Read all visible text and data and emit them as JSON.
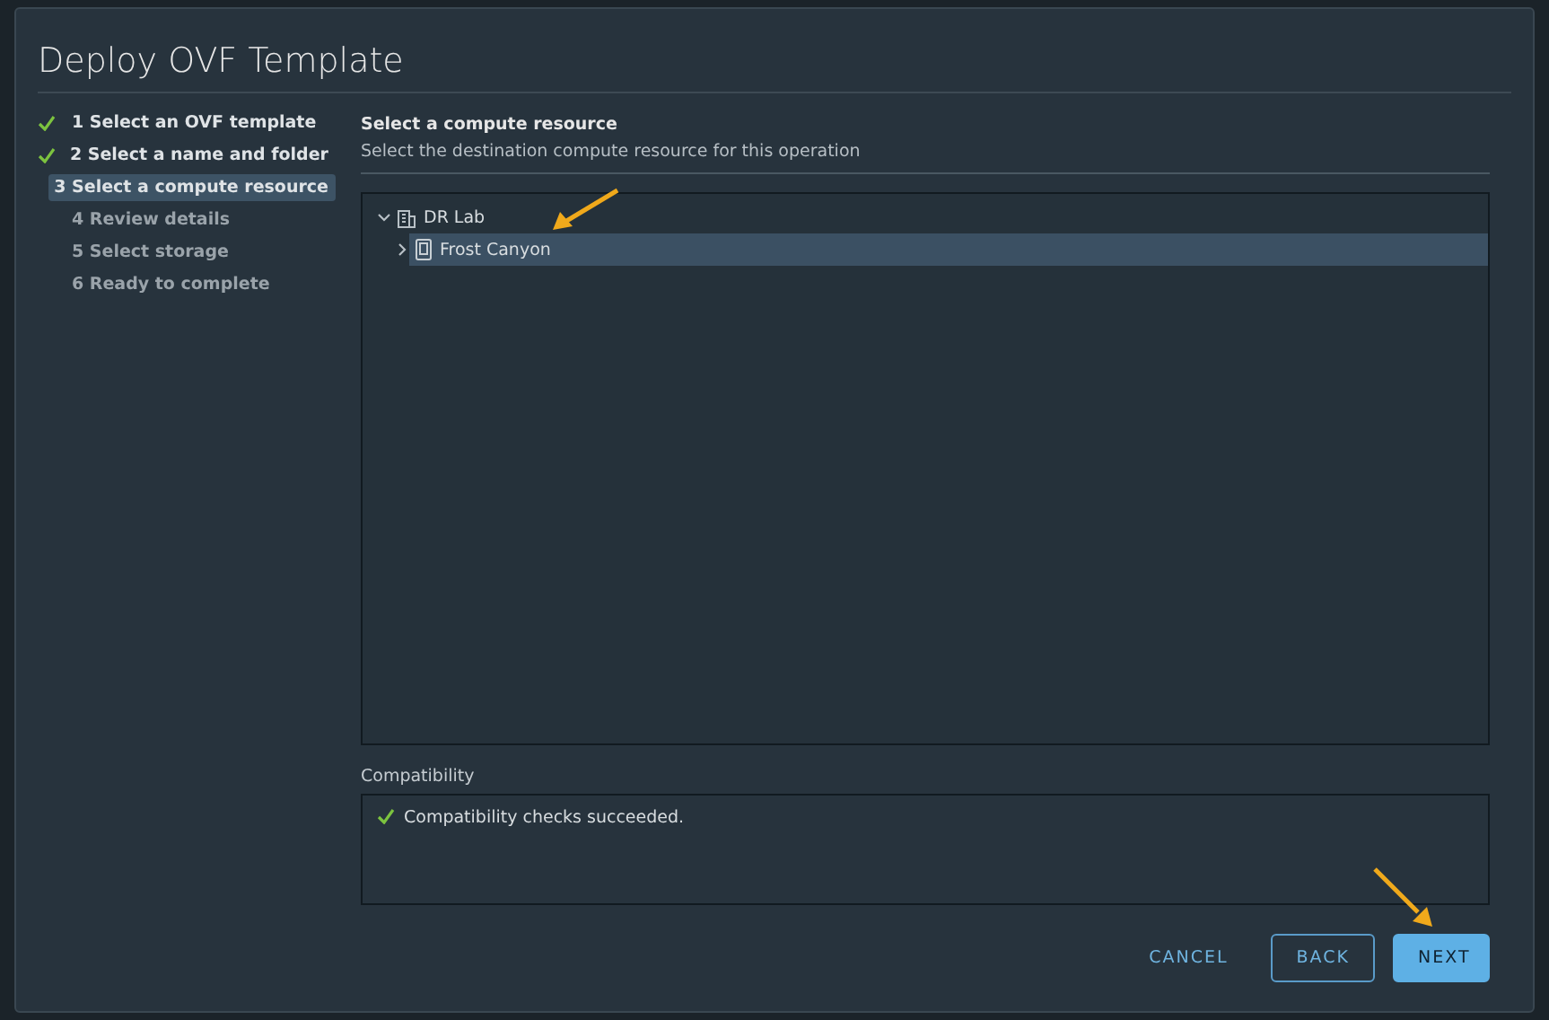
{
  "dialog": {
    "title": "Deploy OVF Template"
  },
  "steps": [
    {
      "label": "1 Select an OVF template",
      "done": true,
      "selected": false,
      "disabled": false
    },
    {
      "label": "2 Select a name and folder",
      "done": true,
      "selected": false,
      "disabled": false
    },
    {
      "label": "3 Select a compute resource",
      "done": false,
      "selected": true,
      "disabled": false
    },
    {
      "label": "4 Review details",
      "done": false,
      "selected": false,
      "disabled": true
    },
    {
      "label": "5 Select storage",
      "done": false,
      "selected": false,
      "disabled": true
    },
    {
      "label": "6 Ready to complete",
      "done": false,
      "selected": false,
      "disabled": true
    }
  ],
  "page": {
    "heading": "Select a compute resource",
    "description": "Select the destination compute resource for this operation"
  },
  "tree": [
    {
      "label": "DR Lab",
      "kind": "datacenter",
      "expanded": true,
      "selected": false,
      "children": [
        {
          "label": "Frost Canyon",
          "kind": "host",
          "expanded": false,
          "selected": true
        }
      ]
    }
  ],
  "compatibility": {
    "label": "Compatibility",
    "message": "Compatibility checks succeeded.",
    "ok": true
  },
  "buttons": [
    {
      "label": "CANCEL",
      "kind": "link"
    },
    {
      "label": "BACK",
      "kind": "outline"
    },
    {
      "label": "NEXT",
      "kind": "primary"
    }
  ]
}
